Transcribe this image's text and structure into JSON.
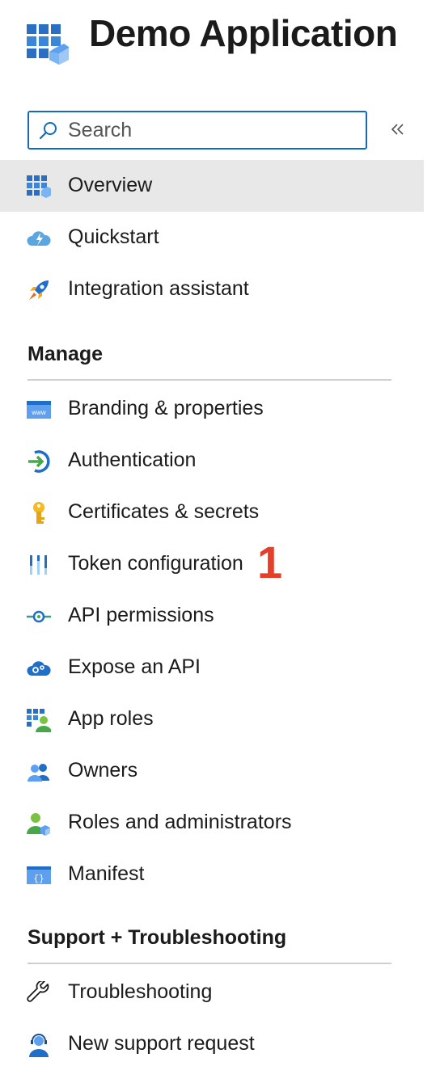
{
  "header": {
    "title": "Demo Application",
    "icon": "app-registration-icon"
  },
  "search": {
    "placeholder": "Search",
    "value": ""
  },
  "collapse": {
    "label": "«",
    "icon": "double-chevron-left-icon"
  },
  "nav_top": [
    {
      "label": "Overview",
      "icon": "overview-grid-icon",
      "active": true
    },
    {
      "label": "Quickstart",
      "icon": "quickstart-cloud-icon"
    },
    {
      "label": "Integration assistant",
      "icon": "rocket-icon"
    }
  ],
  "sections": {
    "manage": {
      "title": "Manage",
      "items": [
        {
          "label": "Branding & properties",
          "icon": "www-branding-icon"
        },
        {
          "label": "Authentication",
          "icon": "authentication-arrow-icon"
        },
        {
          "label": "Certificates & secrets",
          "icon": "key-icon"
        },
        {
          "label": "Token configuration",
          "icon": "token-bars-icon"
        },
        {
          "label": "API permissions",
          "icon": "api-permissions-icon"
        },
        {
          "label": "Expose an API",
          "icon": "expose-api-cloud-icon"
        },
        {
          "label": "App roles",
          "icon": "app-roles-icon"
        },
        {
          "label": "Owners",
          "icon": "owners-people-icon"
        },
        {
          "label": "Roles and administrators",
          "icon": "roles-admins-icon"
        },
        {
          "label": "Manifest",
          "icon": "manifest-braces-icon"
        }
      ]
    },
    "support": {
      "title": "Support + Troubleshooting",
      "items": [
        {
          "label": "Troubleshooting",
          "icon": "wrench-icon"
        },
        {
          "label": "New support request",
          "icon": "support-agent-icon"
        }
      ]
    }
  },
  "annotation": {
    "marker": "1"
  },
  "colors": {
    "accent": "#0f6cbd",
    "active_bg": "#e8e8e8",
    "marker": "#e43f2b",
    "divider": "#cfcfcf"
  }
}
